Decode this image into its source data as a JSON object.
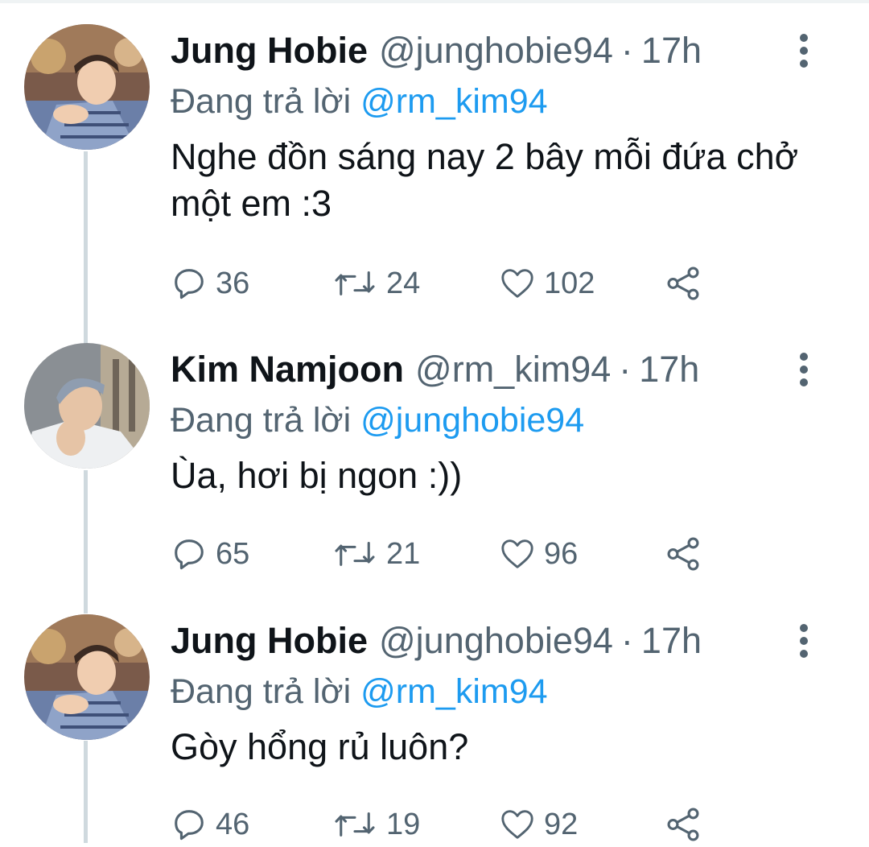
{
  "reply_prefix": "Đang trả lời",
  "colors": {
    "link": "#1d9bf0",
    "secondary": "#536471",
    "text": "#0f1419",
    "thread_line": "#cfd9de"
  },
  "tweets": [
    {
      "name": "Jung Hobie",
      "handle": "@junghobie94",
      "separator": "·",
      "time": "17h",
      "reply_to": "@rm_kim94",
      "text": "Nghe đồn sáng nay 2 bây mỗi đứa chở một em :3",
      "replies": "36",
      "retweets": "24",
      "likes": "102"
    },
    {
      "name": "Kim Namjoon",
      "handle": "@rm_kim94",
      "separator": "·",
      "time": "17h",
      "reply_to": "@junghobie94",
      "text": "Ùa, hơi bị ngon :))",
      "replies": "65",
      "retweets": "21",
      "likes": "96"
    },
    {
      "name": "Jung Hobie",
      "handle": "@junghobie94",
      "separator": "·",
      "time": "17h",
      "reply_to": "@rm_kim94",
      "text": "Gòy hổng rủ luôn?",
      "replies": "46",
      "retweets": "19",
      "likes": "92"
    }
  ],
  "icons": {
    "reply": "reply-icon",
    "retweet": "retweet-icon",
    "like": "heart-icon",
    "share": "share-icon",
    "more": "more-vertical-icon"
  }
}
